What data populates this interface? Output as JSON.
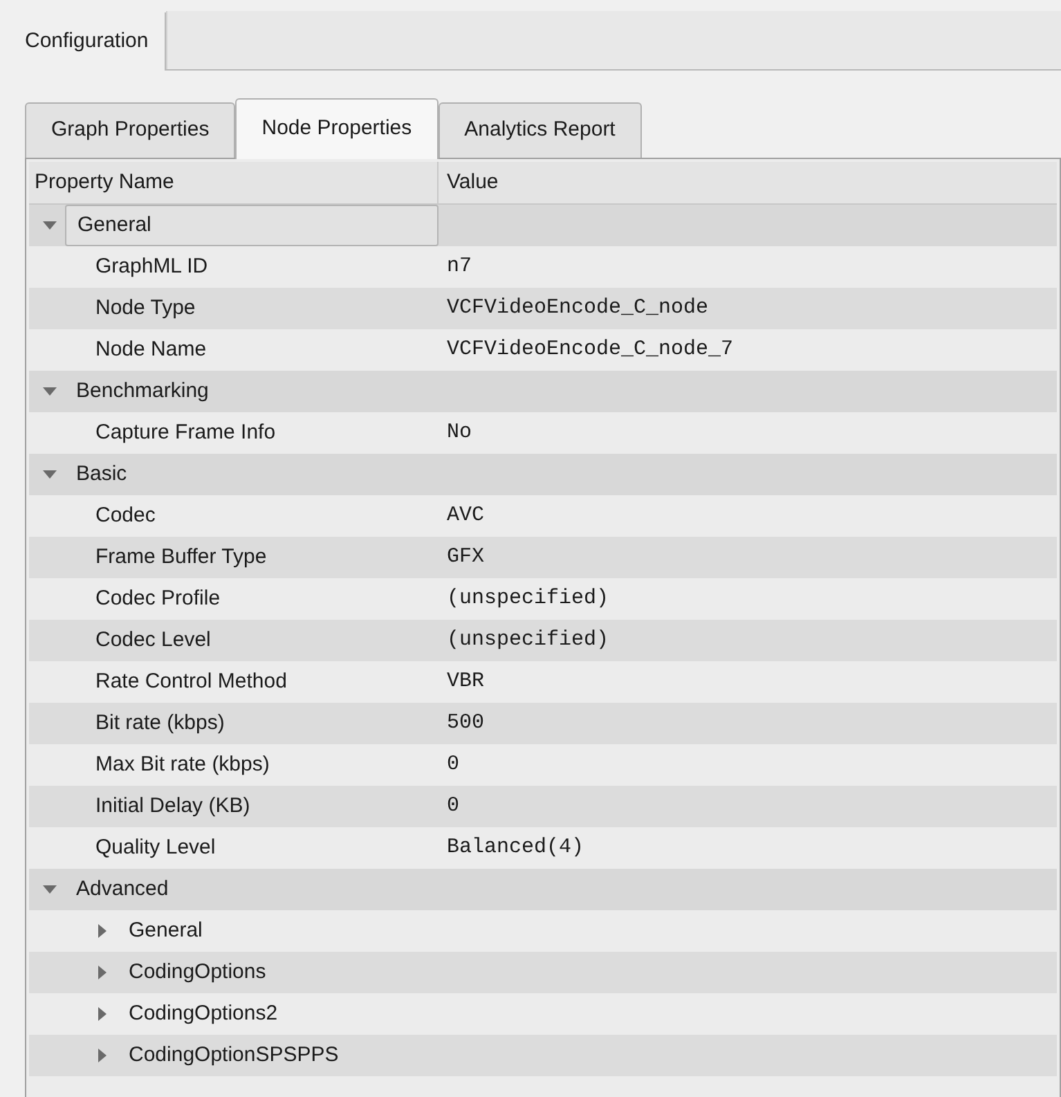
{
  "outer_tabs": [
    {
      "label": "Configuration",
      "selected": true
    }
  ],
  "tabs": [
    {
      "label": "Graph Properties",
      "selected": false
    },
    {
      "label": "Node Properties",
      "selected": true
    },
    {
      "label": "Analytics Report",
      "selected": false
    }
  ],
  "table": {
    "columns": [
      "Property Name",
      "Value"
    ],
    "rows": [
      {
        "kind": "group",
        "name": "General",
        "expanded": true,
        "selected": true,
        "children": [
          {
            "kind": "property",
            "name": "GraphML ID",
            "value": "n7",
            "selected": false
          },
          {
            "kind": "property",
            "name": "Node Type",
            "value": "VCFVideoEncode_C_node",
            "selected": false
          },
          {
            "kind": "property",
            "name": "Node Name",
            "value": "VCFVideoEncode_C_node_7",
            "selected": false
          }
        ]
      },
      {
        "kind": "group",
        "name": "Benchmarking",
        "expanded": true,
        "selected": false,
        "children": [
          {
            "kind": "property",
            "name": "Capture Frame Info",
            "value": "No",
            "selected": false
          }
        ]
      },
      {
        "kind": "group",
        "name": "Basic",
        "expanded": true,
        "selected": false,
        "children": [
          {
            "kind": "property",
            "name": "Codec",
            "value": "AVC",
            "selected": false
          },
          {
            "kind": "property",
            "name": "Frame Buffer Type",
            "value": "GFX",
            "selected": false
          },
          {
            "kind": "property",
            "name": "Codec Profile",
            "value": "(unspecified)",
            "selected": false
          },
          {
            "kind": "property",
            "name": "Codec Level",
            "value": "(unspecified)",
            "selected": false
          },
          {
            "kind": "property",
            "name": "Rate Control Method",
            "value": "VBR",
            "selected": false
          },
          {
            "kind": "property",
            "name": "Bit rate (kbps)",
            "value": "500",
            "selected": false
          },
          {
            "kind": "property",
            "name": "Max Bit rate (kbps)",
            "value": "0",
            "selected": false
          },
          {
            "kind": "property",
            "name": "Initial Delay (KB)",
            "value": "0",
            "selected": false
          },
          {
            "kind": "property",
            "name": "Quality Level",
            "value": "Balanced(4)",
            "selected": false
          }
        ]
      },
      {
        "kind": "group",
        "name": "Advanced",
        "expanded": true,
        "selected": false,
        "children": [
          {
            "kind": "group",
            "name": "General",
            "expanded": false,
            "selected": false
          },
          {
            "kind": "group",
            "name": "CodingOptions",
            "expanded": false,
            "selected": false
          },
          {
            "kind": "group",
            "name": "CodingOptions2",
            "expanded": false,
            "selected": false
          },
          {
            "kind": "group",
            "name": "CodingOptionSPSPPS",
            "expanded": false,
            "selected": false
          }
        ]
      }
    ]
  }
}
